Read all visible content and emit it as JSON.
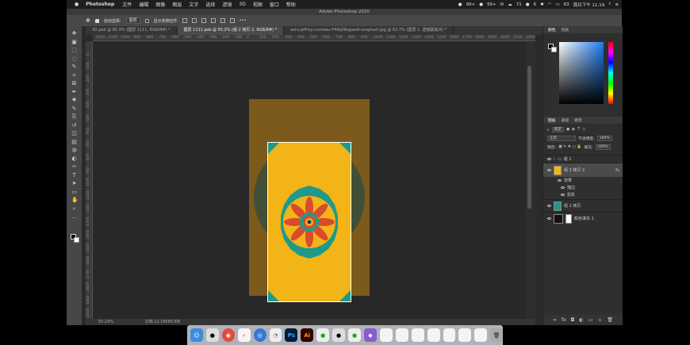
{
  "menubar": {
    "apple": "",
    "app": "Photoshop",
    "items": [
      "文件",
      "编辑",
      "图像",
      "图层",
      "文字",
      "选择",
      "滤镜",
      "3D",
      "视图",
      "窗口",
      "帮助"
    ],
    "status": [
      "99+",
      "99+",
      "71",
      "6",
      "63",
      "周日下午 11:19"
    ]
  },
  "window": {
    "title": "Adobe Photoshop 2020"
  },
  "options": {
    "auto_select": "自动选择:",
    "layer_select": "图层",
    "transform": "显示变换控件"
  },
  "tabs": [
    {
      "label": "3D.psd @ 65.9% (图层 1111, RGB/8#) *"
    },
    {
      "label": "图层 1111.psb @ 55.2% (组 2 拷贝 2, RGB/8#) *"
    },
    {
      "label": "ezra-jeffrey-comeau-F44q08ogwzA-unsplash.jpg @ 62.7% (图层 1, 透镜蒙版/8) *"
    }
  ],
  "ruler_top": [
    "-1200",
    "-1100",
    "-1000",
    "-900",
    "-800",
    "-700",
    "-600",
    "-500",
    "-400",
    "-300",
    "-200",
    "-100",
    "0",
    "100",
    "200",
    "300",
    "400",
    "500",
    "600",
    "700",
    "800",
    "900",
    "1000",
    "1100",
    "1200",
    "1300",
    "1400",
    "1500",
    "1600",
    "1700",
    "1800",
    "1900",
    "2000",
    "2100",
    "2200"
  ],
  "ruler_left": [
    "0",
    "100",
    "200",
    "300",
    "400",
    "500",
    "600",
    "700",
    "800",
    "900",
    "1000",
    "1100",
    "1200",
    "1300",
    "1400",
    "1500",
    "1600",
    "1700",
    "1800",
    "1900",
    "2000"
  ],
  "status": {
    "zoom": "55.24%",
    "doc": "文档:11.1M/66.6M"
  },
  "panels": {
    "color_tabs": [
      "颜色",
      "色板"
    ],
    "layer_tabs": [
      "图层",
      "通道",
      "路径"
    ],
    "filter": "类型",
    "blend": "正常",
    "opacity_label": "不透明度:",
    "opacity": "100%",
    "lock_label": "锁定:",
    "fill_label": "填充:",
    "fill": "100%",
    "layers": [
      {
        "name": "组 1",
        "type": "group"
      },
      {
        "name": "组 2 拷贝 2",
        "fx": "fx",
        "selected": true
      },
      {
        "name": "效果",
        "sub": true
      },
      {
        "name": "描边",
        "sub": true
      },
      {
        "name": "投影",
        "sub": true
      },
      {
        "name": "组 2 拷贝"
      },
      {
        "name": "颜色填充 1"
      }
    ]
  },
  "colors": {
    "accent": "#f3b417",
    "teal": "#1f9a8a",
    "red": "#d84b2f",
    "navy": "#233a5a",
    "canvas": "#282828"
  }
}
